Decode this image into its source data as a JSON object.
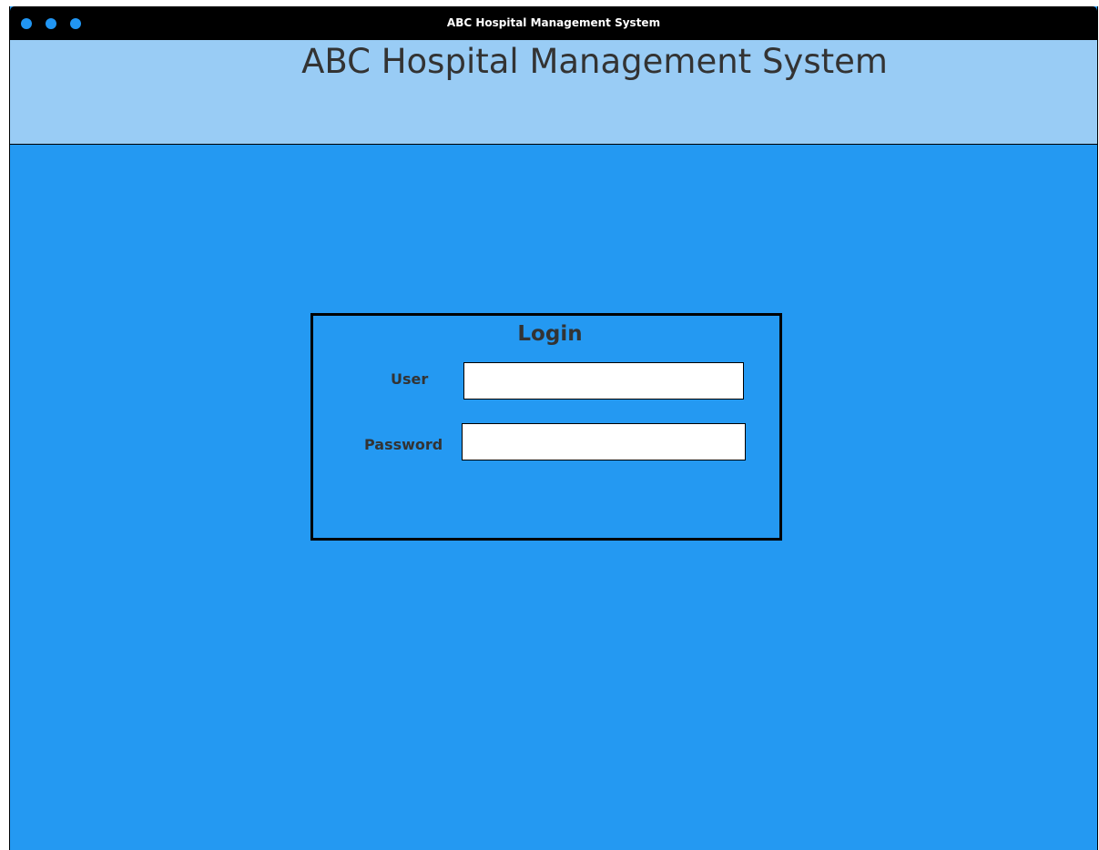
{
  "window": {
    "title": "ABC Hospital Management System"
  },
  "header": {
    "title": "ABC Hospital Management System"
  },
  "login": {
    "title": "Login",
    "user_label": "User",
    "user_value": "",
    "password_label": "Password",
    "password_value": ""
  },
  "colors": {
    "background": "#2499f2",
    "header": "#99ccf5",
    "titlebar": "#000000",
    "dots": "#2196f3",
    "text": "#333333"
  },
  "icons": {
    "window_controls": [
      "window-dot-icon",
      "window-dot-icon",
      "window-dot-icon"
    ]
  }
}
